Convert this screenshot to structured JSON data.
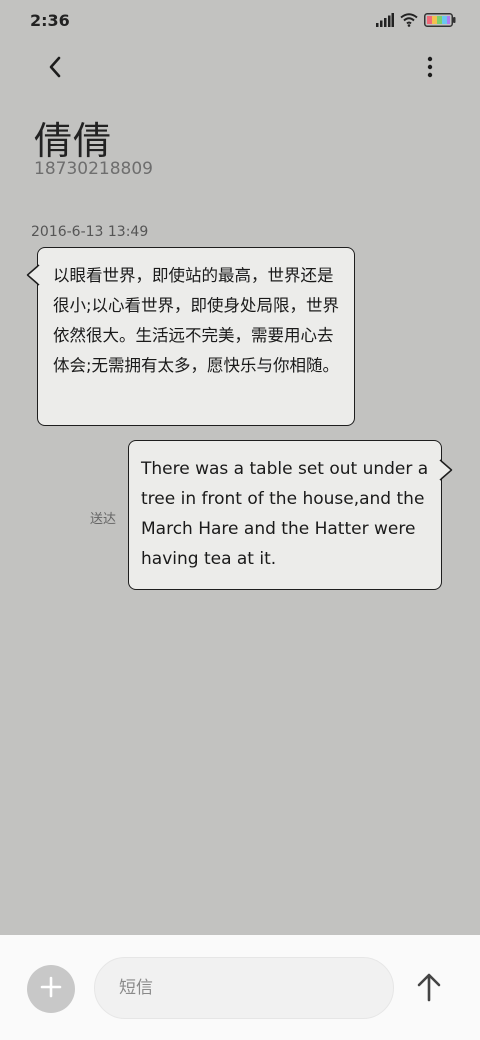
{
  "status_bar": {
    "time": "2:36"
  },
  "contact": {
    "name": "倩倩",
    "number": "18730218809"
  },
  "conversation": {
    "timestamp": "2016-6-13 13:49",
    "incoming_message": "以眼看世界，即使站的最高，世界还是很小;以心看世界，即使身处局限，世界依然很大。生活远不完美，需要用心去体会;无需拥有太多，愿快乐与你相随。",
    "outgoing_message": "There was a table set out under a tree in front of the house,and the March Hare and the Hatter were having tea at it.",
    "outgoing_status": "送达"
  },
  "composer": {
    "placeholder": "短信"
  },
  "icons": {
    "back": "chevron-left-icon",
    "more": "more-vertical-icon",
    "add": "plus-icon",
    "send": "arrow-up-icon",
    "signal": "signal-icon",
    "wifi": "wifi-icon",
    "battery": "battery-icon"
  },
  "colors": {
    "background": "#c2c2c0",
    "bubble": "#ececea",
    "bubble_border": "#1e1e1e",
    "input_bar": "#fafafa"
  }
}
